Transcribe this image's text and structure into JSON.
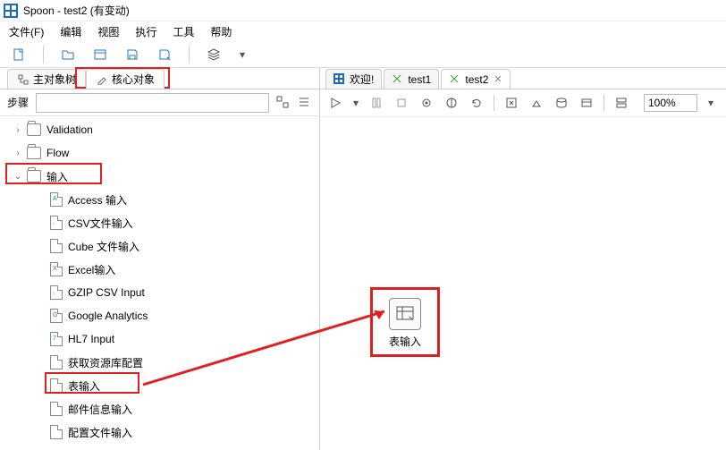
{
  "title": "Spoon - test2 (有变动)",
  "menu": {
    "file": "文件(F)",
    "edit": "编辑",
    "view": "视图",
    "run": "执行",
    "tools": "工具",
    "help": "帮助"
  },
  "sidebar": {
    "tabs": {
      "main_tree": "主对象树",
      "core": "核心对象"
    },
    "steps_label": "步骤",
    "search_placeholder": "",
    "tree": {
      "validation": "Validation",
      "flow": "Flow",
      "input": "输入",
      "items": [
        "Access 输入",
        "CSV文件输入",
        "Cube 文件输入",
        "Excel输入",
        "GZIP CSV Input",
        "Google Analytics",
        "HL7 Input",
        "获取资源库配置",
        "表输入",
        "邮件信息输入",
        "配置文件输入"
      ],
      "item_badges": [
        "A",
        ",",
        "",
        "X",
        ",",
        "G",
        "7",
        "",
        "",
        "",
        ""
      ]
    }
  },
  "content": {
    "tabs": {
      "welcome": "欢迎!",
      "test1": "test1",
      "test2": "test2"
    },
    "zoom": "100%",
    "node_label": "表输入"
  }
}
